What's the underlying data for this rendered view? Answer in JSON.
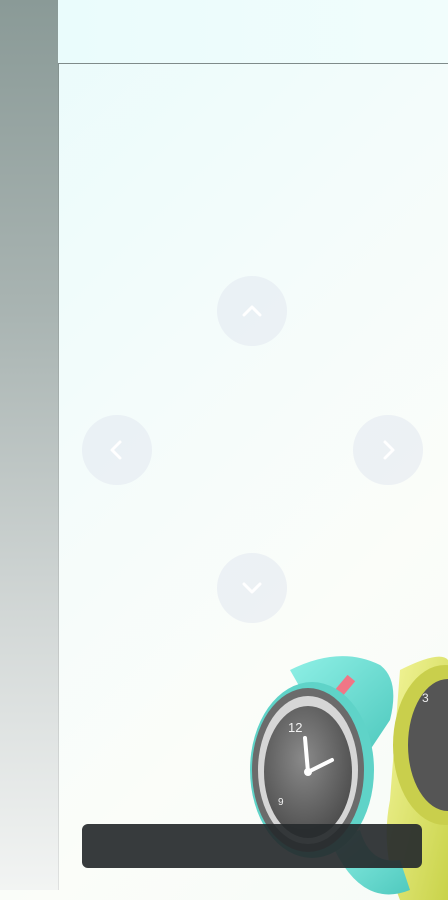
{
  "app": {
    "title": "",
    "bottom_bar_text": ""
  },
  "nav": {
    "up": {
      "icon": "chevron-up-icon"
    },
    "down": {
      "icon": "chevron-down-icon"
    },
    "left": {
      "icon": "chevron-left-icon"
    },
    "right": {
      "icon": "chevron-right-icon"
    }
  },
  "product_image": {
    "subject": "watch",
    "colors": [
      "#74d9cf",
      "#e7ef68",
      "#6d6d6d"
    ]
  },
  "colors": {
    "sidebar_top": "#8a9a97",
    "nav_button": "#e2e8f0",
    "bottom_bar": "#262a2d"
  }
}
